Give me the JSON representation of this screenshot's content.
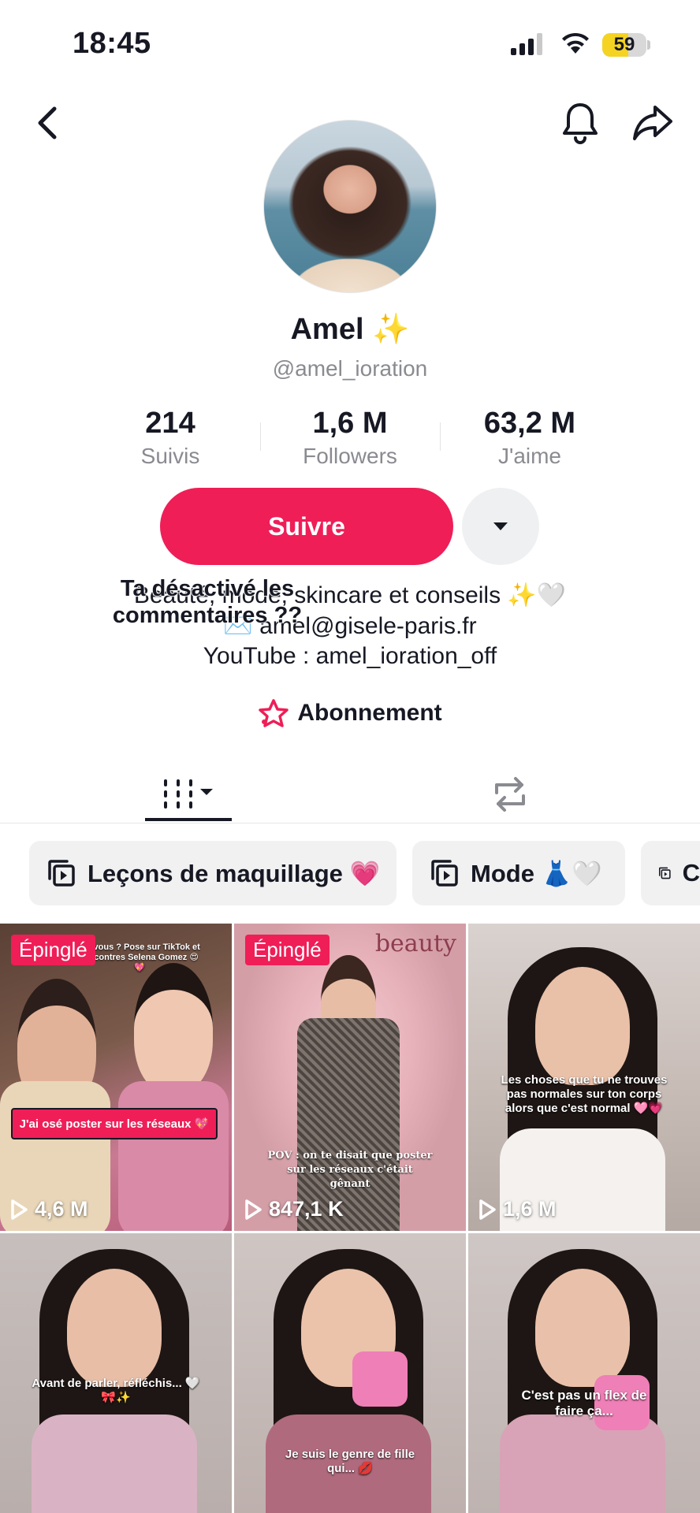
{
  "status_bar": {
    "time": "18:45",
    "battery": "59",
    "battery_level": 0.59
  },
  "header": {
    "back_icon": "chevron-left-icon",
    "bell_icon": "bell-icon",
    "share_icon": "share-arrow-icon"
  },
  "profile": {
    "name": "Amel",
    "name_emoji": "✨",
    "handle": "@amel_ioration",
    "stats": [
      {
        "value": "214",
        "label": "Suivis"
      },
      {
        "value": "1,6 M",
        "label": "Followers"
      },
      {
        "value": "63,2 M",
        "label": "J'aime"
      }
    ],
    "follow_label": "Suivre",
    "bio": [
      "Beauté, mode, skincare et conseils ✨🤍",
      "✉️ amel@gisele-paris.fr",
      "YouTube : amel_ioration_off"
    ],
    "overlay_caption": "Ta désactivé les commentaires ??",
    "subscription_label": "Abonnement"
  },
  "tabs": {
    "videos_icon": "grid-bars-icon",
    "reposts_icon": "repost-icon"
  },
  "playlists": [
    {
      "label": "Leçons de maquillage 💗"
    },
    {
      "label": "Mode 👗🤍"
    },
    {
      "label": "C"
    }
  ],
  "videos": [
    {
      "pinned": "Épinglé",
      "views": "4,6 M",
      "caption_top": "lez-vous ? Pose sur TikTok et rencontres Selena Gomez 😍💖",
      "caption_box": "J'ai osé poster sur les réseaux 💖"
    },
    {
      "pinned": "Épinglé",
      "views": "847,1 K",
      "brand": "beauty",
      "caption": "POV : on te disait que poster sur les réseaux c'était gênant"
    },
    {
      "views": "1,6 M",
      "caption": "Les choses que tu ne trouves pas normales sur ton corps alors que c'est normal 🩷💗"
    },
    {
      "caption": "Avant de parler, réfléchis... 🤍🎀✨"
    },
    {
      "caption": "Je suis le genre de fille qui... 💋"
    },
    {
      "caption": "C'est pas un flex de faire ça..."
    }
  ],
  "colors": {
    "accent": "#ef1e57",
    "text": "#161823",
    "muted": "#8a8b91"
  }
}
